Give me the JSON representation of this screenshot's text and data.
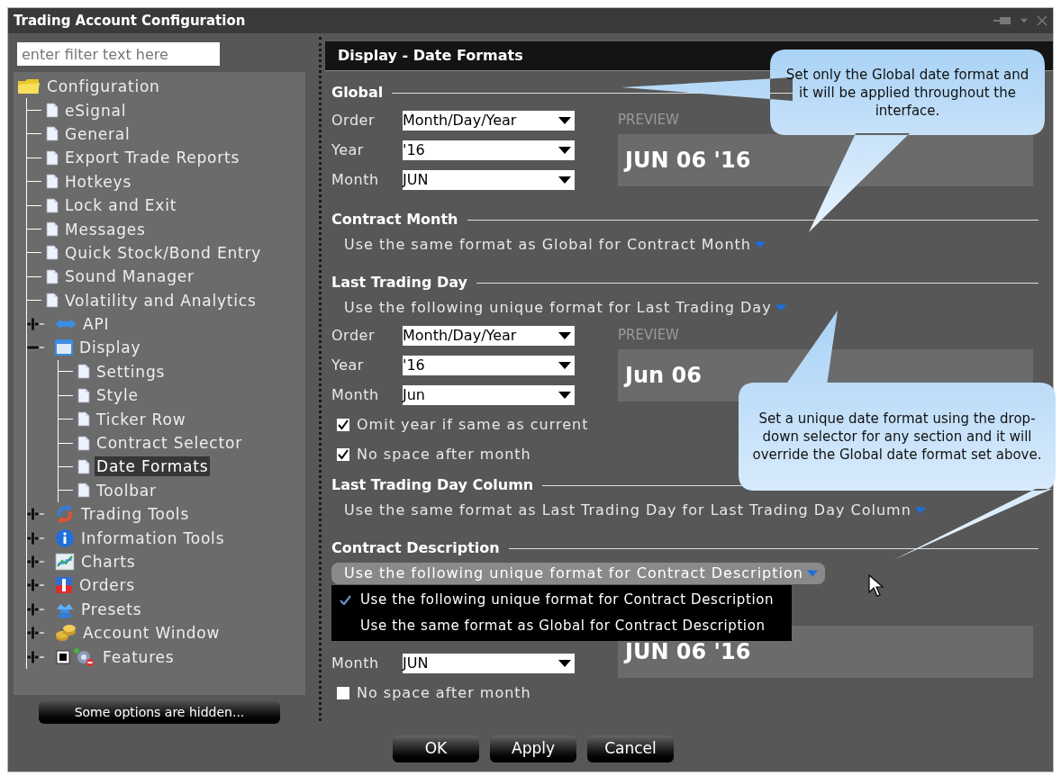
{
  "window": {
    "title": "Trading Account Configuration"
  },
  "sidebar": {
    "filter": {
      "placeholder": "enter filter text here"
    },
    "tree": [
      {
        "label": "Configuration",
        "kind": "folder",
        "selected": false,
        "children": [
          {
            "label": "eSignal",
            "kind": "page",
            "selected": false
          },
          {
            "label": "General",
            "kind": "page",
            "selected": false
          },
          {
            "label": "Export Trade Reports",
            "kind": "page",
            "selected": false
          },
          {
            "label": "Hotkeys",
            "kind": "page",
            "selected": false
          },
          {
            "label": "Lock and Exit",
            "kind": "page",
            "selected": false
          },
          {
            "label": "Messages",
            "kind": "page",
            "selected": false
          },
          {
            "label": "Quick Stock/Bond Entry",
            "kind": "page",
            "selected": false
          },
          {
            "label": "Sound Manager",
            "kind": "page",
            "selected": false
          },
          {
            "label": "Volatility and Analytics",
            "kind": "page",
            "selected": false
          },
          {
            "label": "API",
            "kind": "api",
            "selected": false,
            "expanded": false
          },
          {
            "label": "Display",
            "kind": "display",
            "selected": false,
            "expanded": true,
            "children": [
              {
                "label": "Settings",
                "kind": "page",
                "selected": false
              },
              {
                "label": "Style",
                "kind": "page",
                "selected": false
              },
              {
                "label": "Ticker Row",
                "kind": "page",
                "selected": false
              },
              {
                "label": "Contract Selector",
                "kind": "page",
                "selected": false
              },
              {
                "label": "Date Formats",
                "kind": "page",
                "selected": true
              },
              {
                "label": "Toolbar",
                "kind": "page",
                "selected": false
              }
            ]
          },
          {
            "label": "Trading Tools",
            "kind": "trading",
            "selected": false,
            "expanded": false
          },
          {
            "label": "Information Tools",
            "kind": "info",
            "selected": false,
            "expanded": false
          },
          {
            "label": "Charts",
            "kind": "charts",
            "selected": false,
            "expanded": false
          },
          {
            "label": "Orders",
            "kind": "orders",
            "selected": false,
            "expanded": false
          },
          {
            "label": "Presets",
            "kind": "presets",
            "selected": false,
            "expanded": false
          },
          {
            "label": "Account Window",
            "kind": "account",
            "selected": false,
            "expanded": false
          },
          {
            "label": "Features",
            "kind": "features",
            "selected": false,
            "expanded": false
          }
        ]
      }
    ],
    "hidden_button": "Some options are hidden..."
  },
  "panel": {
    "title": "Display - Date Formats",
    "sections": [
      {
        "heading": "Global",
        "fields": [
          {
            "label": "Order",
            "value": "Month/Day/Year"
          },
          {
            "label": "Year",
            "value": "'16"
          },
          {
            "label": "Month",
            "value": "JUN"
          }
        ],
        "preview_label": "PREVIEW",
        "preview": "JUN 06 '16"
      },
      {
        "heading": "Contract Month",
        "mode": {
          "text": "Use the same format as Global for Contract Month",
          "open": false
        }
      },
      {
        "heading": "Last Trading Day",
        "mode": {
          "text": "Use the following unique format for Last Trading Day",
          "open": false
        },
        "fields": [
          {
            "label": "Order",
            "value": "Month/Day/Year"
          },
          {
            "label": "Year",
            "value": "'16"
          },
          {
            "label": "Month",
            "value": "Jun"
          }
        ],
        "preview_label": "PREVIEW",
        "preview": "Jun 06",
        "checkboxes": [
          {
            "label": "Omit year if same as current",
            "checked": true
          },
          {
            "label": "No space after month",
            "checked": true
          }
        ]
      },
      {
        "heading": "Last Trading Day Column",
        "mode": {
          "text": "Use the same format as Last Trading Day for Last Trading Day Column",
          "open": false
        }
      },
      {
        "heading": "Contract Description",
        "mode": {
          "text": "Use the following unique format for Contract Description",
          "open": true,
          "options": [
            {
              "label": "Use the following unique format for Contract Description",
              "selected": true
            },
            {
              "label": "Use the same format as Global for Contract Description",
              "selected": false
            }
          ]
        },
        "fields": [
          {
            "label": "Month",
            "value": "JUN"
          }
        ],
        "preview": "JUN 06 '16",
        "checkboxes": [
          {
            "label": "No space after month",
            "checked": false
          }
        ]
      }
    ]
  },
  "callouts": [
    {
      "text": "Set only the Global date format and it will be applied throughout the interface."
    },
    {
      "text": "Set a unique date format using the drop-down selector for any section and it will override the Global date format set above."
    }
  ],
  "buttons": [
    "OK",
    "Apply",
    "Cancel"
  ]
}
